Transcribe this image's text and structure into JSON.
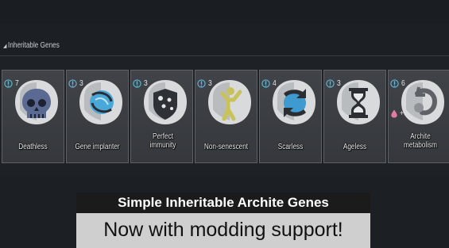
{
  "section": {
    "title": "Inheritable Genes"
  },
  "colors": {
    "complexity": "#5fb6d9",
    "metabolism": "#e27aa3",
    "icon_bg": "#d8dadc",
    "icon_fg": "#2a2d31"
  },
  "genes": [
    {
      "name": "Deathless",
      "complexity": "7",
      "icon": "skull-icon"
    },
    {
      "name": "Gene implanter",
      "complexity": "3",
      "icon": "gene-implanter-icon"
    },
    {
      "name": "Perfect immunity",
      "complexity": "3",
      "icon": "immunity-icon"
    },
    {
      "name": "Non-senescent",
      "complexity": "3",
      "icon": "non-senescent-icon"
    },
    {
      "name": "Scarless",
      "complexity": "4",
      "icon": "scarless-icon"
    },
    {
      "name": "Ageless",
      "complexity": "3",
      "icon": "hourglass-icon"
    },
    {
      "name": "Archite metabolism",
      "complexity": "6",
      "metabolism": "+6",
      "icon": "archite-metabolism-icon"
    }
  ],
  "banner": {
    "line1": "Simple Inheritable Archite Genes",
    "line2": "Now with modding support!"
  }
}
